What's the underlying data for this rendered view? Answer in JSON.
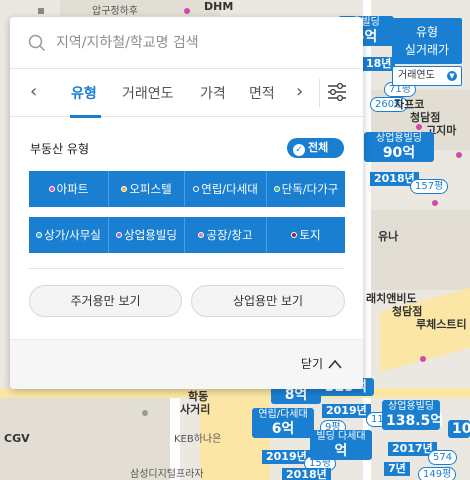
{
  "search": {
    "placeholder": "지역/지하철/학교명 검색"
  },
  "tabs": [
    {
      "label": "유형",
      "active": true
    },
    {
      "label": "거래연도",
      "active": false
    },
    {
      "label": "가격",
      "active": false
    },
    {
      "label": "면적",
      "active": false
    }
  ],
  "property_type": {
    "title": "부동산 유형",
    "all_label": "전체",
    "row1": [
      {
        "label": "아파트",
        "dot": "#e84fbf"
      },
      {
        "label": "오피스텔",
        "dot": "#f5b52a"
      },
      {
        "label": "연립/다세대",
        "dot": "#1a7fd1"
      },
      {
        "label": "단독/다가구",
        "dot": "#3dbf7a"
      }
    ],
    "row2": [
      {
        "label": "상가/사무실",
        "dot": "#2ab5c9"
      },
      {
        "label": "상업용빌딩",
        "dot": "#b05be0"
      },
      {
        "label": "공장/창고",
        "dot": "#e07aa8"
      },
      {
        "label": "토지",
        "dot": "#8a2a2a"
      }
    ]
  },
  "buttons": {
    "residential": "주거용만 보기",
    "commercial": "상업용만 보기"
  },
  "footer": {
    "close_label": "닫기"
  },
  "side_control": {
    "line1": "유형",
    "line2": "실거래가",
    "select_value": "거래연도"
  },
  "map": {
    "labels": [
      "압구정하후",
      "DHM",
      "용빌딩",
      "5억",
      "18년",
      "71평",
      "260평",
      "자프코",
      "청담점",
      "고지마",
      "상업용빌딩",
      "90억",
      "2018년",
      "157평",
      "유나",
      "래치앤비도",
      "청담점",
      "루체스트티",
      "학동",
      "사거리",
      "CGV",
      "KEB하나은",
      "삼성디지털프라자",
      "8억",
      "329억",
      "2019년",
      "1198평",
      "연립/다세대",
      "6억",
      "9평",
      "상업용빌딩",
      "138.5억",
      "2017년",
      "574",
      "2019년",
      "15평",
      "빌딩 다세대",
      "억",
      "7년",
      "149평",
      "2018년",
      "10"
    ]
  }
}
